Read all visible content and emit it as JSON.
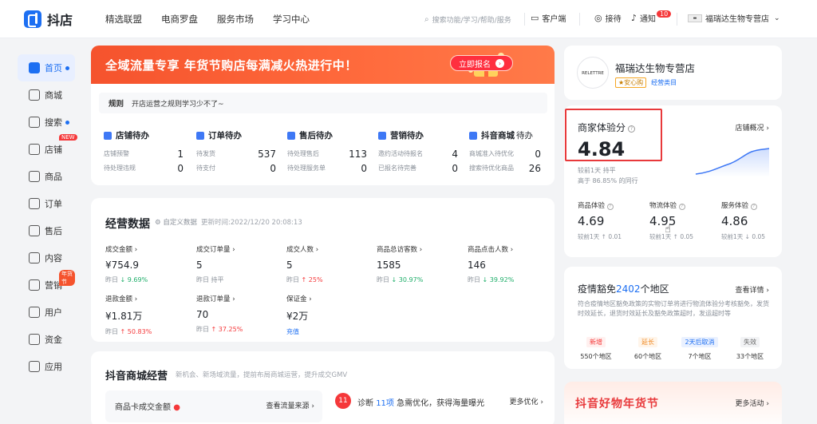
{
  "header": {
    "logo_text": "抖店",
    "nav": [
      "精选联盟",
      "电商罗盘",
      "服务市场",
      "学习中心"
    ],
    "search_placeholder": "搜索功能/学习/帮助/服务",
    "customer_service": "客户端",
    "ticket": "接待",
    "notice": "通知",
    "notice_count": "10",
    "shop_name": "福瑞达生物专营店"
  },
  "sidebar": {
    "items": [
      {
        "label": "首页",
        "active": true,
        "dot": true,
        "tag": ""
      },
      {
        "label": "商城",
        "active": false,
        "dot": false,
        "tag": ""
      },
      {
        "label": "搜索",
        "active": false,
        "dot": true,
        "tag": ""
      },
      {
        "label": "店铺",
        "active": false,
        "dot": false,
        "tag": "NEW"
      },
      {
        "label": "商品",
        "active": false,
        "dot": false,
        "tag": ""
      },
      {
        "label": "订单",
        "active": false,
        "dot": false,
        "tag": ""
      },
      {
        "label": "售后",
        "active": false,
        "dot": false,
        "tag": ""
      },
      {
        "label": "内容",
        "active": false,
        "dot": false,
        "tag": ""
      },
      {
        "label": "营销",
        "active": false,
        "dot": false,
        "tag": "年货节"
      },
      {
        "label": "用户",
        "active": false,
        "dot": false,
        "tag": ""
      },
      {
        "label": "资金",
        "active": false,
        "dot": false,
        "tag": ""
      },
      {
        "label": "应用",
        "active": false,
        "dot": false,
        "tag": ""
      }
    ]
  },
  "banner": {
    "text": "全域流量专享 年货节购店每满减火热进行中！",
    "button": "立即报名"
  },
  "notice_bar": {
    "tag": "规则",
    "text": "开店运营之规则学习少不了~"
  },
  "todos": [
    {
      "title": "店铺待办",
      "rows": [
        {
          "label": "店铺预警",
          "value": "1"
        },
        {
          "label": "待处理违规",
          "value": "0"
        }
      ]
    },
    {
      "title": "订单待办",
      "rows": [
        {
          "label": "待发货",
          "value": "537"
        },
        {
          "label": "待支付",
          "value": "0"
        }
      ]
    },
    {
      "title": "售后待办",
      "rows": [
        {
          "label": "待处理售后",
          "value": "113"
        },
        {
          "label": "待处理服务单",
          "value": "0"
        }
      ]
    },
    {
      "title": "营销待办",
      "rows": [
        {
          "label": "邀约活动待报名",
          "value": "4"
        },
        {
          "label": "已报名待完善",
          "value": "0"
        }
      ]
    },
    {
      "title": "抖音商城",
      "title_extra": "待办",
      "rows": [
        {
          "label": "商城准入待优化",
          "value": "0"
        },
        {
          "label": "搜索待优化商品",
          "value": "26"
        }
      ]
    }
  ],
  "business": {
    "title": "经营数据",
    "custom": "自定义数据",
    "updated": "更新时间:2022/12/20 20:08:13",
    "metrics": [
      {
        "label": "成交金额",
        "value": "¥754.9",
        "cmp_prefix": "昨日",
        "cmp": "↓ 9.69%",
        "dir": "down"
      },
      {
        "label": "成交订单量",
        "value": "5",
        "cmp_prefix": "昨日",
        "cmp": "持平",
        "dir": "flat"
      },
      {
        "label": "成交人数",
        "value": "5",
        "cmp_prefix": "昨日",
        "cmp": "↑ 25%",
        "dir": "up"
      },
      {
        "label": "商品总访客数",
        "value": "1585",
        "cmp_prefix": "昨日",
        "cmp": "↓ 30.97%",
        "dir": "down"
      },
      {
        "label": "商品点击人数",
        "value": "146",
        "cmp_prefix": "昨日",
        "cmp": "↓ 39.92%",
        "dir": "down"
      },
      {
        "label": "退款金额",
        "value": "¥1.81万",
        "cmp_prefix": "昨日",
        "cmp": "↑ 50.83%",
        "dir": "up"
      },
      {
        "label": "退款订单量",
        "value": "70",
        "cmp_prefix": "昨日",
        "cmp": "↑ 37.25%",
        "dir": "up"
      },
      {
        "label": "保证金",
        "value": "¥2万",
        "cmp_prefix": "",
        "cmp": "充值",
        "dir": "link"
      }
    ]
  },
  "mall": {
    "title": "抖音商城经营",
    "subtitle": "新机会、新场域流量，提前布局商城运营，提升成交GMV",
    "left_label": "商品卡成交金额",
    "left_link": "查看流量来源",
    "badge_num": "11",
    "diag_prefix": "诊断",
    "diag_count": "11项",
    "diag_suffix": "急需优化，获得海量曝光",
    "more": "更多优化"
  },
  "shop": {
    "avatar_text": "RELETTRE",
    "name": "福瑞达生物专营店",
    "tag": "★安心购",
    "category": "经营类目"
  },
  "experience": {
    "title": "商家体验分",
    "overview": "店铺概况",
    "score": "4.84",
    "line1": "较前1天 持平",
    "line2": "高于 86.85% 的同行",
    "sub": [
      {
        "label": "商品体验",
        "value": "4.69",
        "cmp": "较前1天 ↑ 0.01",
        "dir": "up"
      },
      {
        "label": "物流体验",
        "value": "4.95",
        "cmp": "较前1天 ↑ 0.05",
        "dir": "up"
      },
      {
        "label": "服务体验",
        "value": "4.86",
        "cmp": "较前1天 ↓ 0.05",
        "dir": "down"
      }
    ]
  },
  "epidemic": {
    "title_prefix": "疫情豁免",
    "title_num": "2402",
    "title_suffix": "个地区",
    "detail": "查看详情",
    "desc": "符合疫情地区豁免政策的实物订单将进行物流体验分考核豁免，发货时效延长，退货时效延长及豁免政策超时，发运超时等",
    "stats": [
      {
        "label": "新增",
        "count": "550个地区",
        "color": "#f5383a",
        "bg": "#fff0ef"
      },
      {
        "label": "延长",
        "count": "60个地区",
        "color": "#f08a24",
        "bg": "#fff5ea"
      },
      {
        "label": "2天后取消",
        "count": "7个地区",
        "color": "#1d6ff2",
        "bg": "#eaf1ff"
      },
      {
        "label": "失效",
        "count": "33个地区",
        "color": "#666666",
        "bg": "#f2f3f5"
      }
    ]
  },
  "promo": {
    "title": "抖音好物年货节",
    "more": "更多活动"
  }
}
